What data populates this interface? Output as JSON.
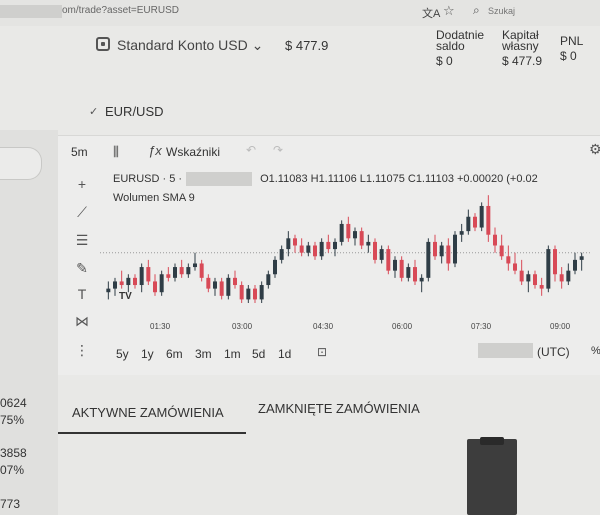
{
  "browser": {
    "url": "om/trade?asset=EURUSD",
    "search_placeholder": "Szukaj",
    "translate_glyph": "文A",
    "star_glyph": "☆",
    "search_glyph": "⌕"
  },
  "header": {
    "account_label": "Standard Konto USD ⌄",
    "balance": "$ 477.9",
    "stats": [
      {
        "label1": "Dodatnie",
        "label2": "saldo",
        "value": "$ 0"
      },
      {
        "label1": "Kapitał",
        "label2": "własny",
        "value": "$ 477.9"
      },
      {
        "label1": "PNL",
        "label2": "",
        "value": "$ 0"
      }
    ]
  },
  "instrument": {
    "check_glyph": "✓",
    "name": "EUR/USD"
  },
  "left_panel": {
    "values": [
      "0624",
      "75%",
      "3858",
      "07%",
      "773"
    ]
  },
  "chart_toolbar": {
    "interval": "5m",
    "candles_glyph": "⫼",
    "fx_glyph": "ƒx",
    "indicators_label": "Wskaźniki",
    "undo_glyph": "↶",
    "redo_glyph": "↷",
    "settings_glyph": "⚙"
  },
  "drawing_tools": {
    "crosshair_glyph": "+",
    "line_glyph": "⟋",
    "fib_glyph": "☰",
    "brush_glyph": "✎",
    "text_glyph": "T",
    "pattern_glyph": "⋈",
    "measure_glyph": "⋮"
  },
  "chart_data": {
    "type": "candlestick",
    "symbol_prefix": "EURUSD · 5 ·",
    "ohlc_text": "O1.11083 H1.11106 L1.11075 C1.11103 +0.00020 (+0.02",
    "volume_label": "Wolumen SMA 9",
    "time_labels": [
      "01:30",
      "03:00",
      "04:30",
      "06:00",
      "07:30",
      "09:00"
    ],
    "up_color": "#2f3d46",
    "down_color": "#d84a57",
    "ref_line": 1.1107,
    "ylim": [
      1.1093,
      1.1125
    ],
    "candles": [
      {
        "o": 1.1096,
        "h": 1.1099,
        "l": 1.1094,
        "c": 1.1097
      },
      {
        "o": 1.1097,
        "h": 1.11,
        "l": 1.1095,
        "c": 1.1099
      },
      {
        "o": 1.1099,
        "h": 1.1102,
        "l": 1.1097,
        "c": 1.1098
      },
      {
        "o": 1.1098,
        "h": 1.1101,
        "l": 1.1096,
        "c": 1.11
      },
      {
        "o": 1.11,
        "h": 1.1101,
        "l": 1.1097,
        "c": 1.1098
      },
      {
        "o": 1.1098,
        "h": 1.1104,
        "l": 1.1096,
        "c": 1.1103
      },
      {
        "o": 1.1103,
        "h": 1.1105,
        "l": 1.1098,
        "c": 1.1099
      },
      {
        "o": 1.1099,
        "h": 1.1101,
        "l": 1.1095,
        "c": 1.1096
      },
      {
        "o": 1.1096,
        "h": 1.1102,
        "l": 1.1095,
        "c": 1.1101
      },
      {
        "o": 1.1101,
        "h": 1.1103,
        "l": 1.1099,
        "c": 1.11
      },
      {
        "o": 1.11,
        "h": 1.1104,
        "l": 1.1099,
        "c": 1.1103
      },
      {
        "o": 1.1103,
        "h": 1.1105,
        "l": 1.11,
        "c": 1.1101
      },
      {
        "o": 1.1101,
        "h": 1.1104,
        "l": 1.11,
        "c": 1.1103
      },
      {
        "o": 1.1103,
        "h": 1.1107,
        "l": 1.1102,
        "c": 1.1104
      },
      {
        "o": 1.1104,
        "h": 1.1105,
        "l": 1.1099,
        "c": 1.11
      },
      {
        "o": 1.11,
        "h": 1.1101,
        "l": 1.1096,
        "c": 1.1097
      },
      {
        "o": 1.1097,
        "h": 1.11,
        "l": 1.1095,
        "c": 1.1099
      },
      {
        "o": 1.1099,
        "h": 1.11,
        "l": 1.1094,
        "c": 1.1095
      },
      {
        "o": 1.1095,
        "h": 1.1101,
        "l": 1.1094,
        "c": 1.11
      },
      {
        "o": 1.11,
        "h": 1.1102,
        "l": 1.1097,
        "c": 1.1098
      },
      {
        "o": 1.1098,
        "h": 1.1099,
        "l": 1.1093,
        "c": 1.1094
      },
      {
        "o": 1.1094,
        "h": 1.1098,
        "l": 1.1093,
        "c": 1.1097
      },
      {
        "o": 1.1097,
        "h": 1.1098,
        "l": 1.1093,
        "c": 1.1094
      },
      {
        "o": 1.1094,
        "h": 1.1099,
        "l": 1.1093,
        "c": 1.1098
      },
      {
        "o": 1.1098,
        "h": 1.1102,
        "l": 1.1097,
        "c": 1.1101
      },
      {
        "o": 1.1101,
        "h": 1.1106,
        "l": 1.11,
        "c": 1.1105
      },
      {
        "o": 1.1105,
        "h": 1.1109,
        "l": 1.1104,
        "c": 1.1108
      },
      {
        "o": 1.1108,
        "h": 1.1113,
        "l": 1.1106,
        "c": 1.1111
      },
      {
        "o": 1.1111,
        "h": 1.1112,
        "l": 1.1107,
        "c": 1.1109
      },
      {
        "o": 1.1109,
        "h": 1.1111,
        "l": 1.1106,
        "c": 1.1107
      },
      {
        "o": 1.1107,
        "h": 1.111,
        "l": 1.1106,
        "c": 1.1109
      },
      {
        "o": 1.1109,
        "h": 1.111,
        "l": 1.1105,
        "c": 1.1106
      },
      {
        "o": 1.1106,
        "h": 1.1111,
        "l": 1.1105,
        "c": 1.111
      },
      {
        "o": 1.111,
        "h": 1.1112,
        "l": 1.1107,
        "c": 1.1108
      },
      {
        "o": 1.1108,
        "h": 1.1111,
        "l": 1.1106,
        "c": 1.111
      },
      {
        "o": 1.111,
        "h": 1.1116,
        "l": 1.1109,
        "c": 1.1115
      },
      {
        "o": 1.1115,
        "h": 1.1117,
        "l": 1.111,
        "c": 1.1111
      },
      {
        "o": 1.1111,
        "h": 1.1114,
        "l": 1.1109,
        "c": 1.1113
      },
      {
        "o": 1.1113,
        "h": 1.1114,
        "l": 1.1108,
        "c": 1.1109
      },
      {
        "o": 1.1109,
        "h": 1.1112,
        "l": 1.1107,
        "c": 1.111
      },
      {
        "o": 1.111,
        "h": 1.1111,
        "l": 1.1104,
        "c": 1.1105
      },
      {
        "o": 1.1105,
        "h": 1.1109,
        "l": 1.1104,
        "c": 1.1108
      },
      {
        "o": 1.1108,
        "h": 1.1109,
        "l": 1.1101,
        "c": 1.1102
      },
      {
        "o": 1.1102,
        "h": 1.1106,
        "l": 1.11,
        "c": 1.1105
      },
      {
        "o": 1.1105,
        "h": 1.1106,
        "l": 1.1099,
        "c": 1.11
      },
      {
        "o": 1.11,
        "h": 1.1104,
        "l": 1.1099,
        "c": 1.1103
      },
      {
        "o": 1.1103,
        "h": 1.1105,
        "l": 1.1098,
        "c": 1.1099
      },
      {
        "o": 1.1099,
        "h": 1.1101,
        "l": 1.1096,
        "c": 1.11
      },
      {
        "o": 1.11,
        "h": 1.1111,
        "l": 1.1099,
        "c": 1.111
      },
      {
        "o": 1.111,
        "h": 1.1112,
        "l": 1.1105,
        "c": 1.1106
      },
      {
        "o": 1.1106,
        "h": 1.111,
        "l": 1.1104,
        "c": 1.1109
      },
      {
        "o": 1.1109,
        "h": 1.1111,
        "l": 1.1102,
        "c": 1.1104
      },
      {
        "o": 1.1104,
        "h": 1.1113,
        "l": 1.1103,
        "c": 1.1112
      },
      {
        "o": 1.1112,
        "h": 1.1115,
        "l": 1.111,
        "c": 1.1113
      },
      {
        "o": 1.1113,
        "h": 1.1119,
        "l": 1.1112,
        "c": 1.1117
      },
      {
        "o": 1.1117,
        "h": 1.1118,
        "l": 1.1113,
        "c": 1.1114
      },
      {
        "o": 1.1114,
        "h": 1.1121,
        "l": 1.1113,
        "c": 1.112
      },
      {
        "o": 1.112,
        "h": 1.1123,
        "l": 1.111,
        "c": 1.1112
      },
      {
        "o": 1.1112,
        "h": 1.1114,
        "l": 1.1107,
        "c": 1.1109
      },
      {
        "o": 1.1109,
        "h": 1.1112,
        "l": 1.1105,
        "c": 1.1106
      },
      {
        "o": 1.1106,
        "h": 1.1109,
        "l": 1.1102,
        "c": 1.1104
      },
      {
        "o": 1.1104,
        "h": 1.1107,
        "l": 1.1101,
        "c": 1.1102
      },
      {
        "o": 1.1102,
        "h": 1.1105,
        "l": 1.1098,
        "c": 1.1099
      },
      {
        "o": 1.1099,
        "h": 1.1102,
        "l": 1.1096,
        "c": 1.1101
      },
      {
        "o": 1.1101,
        "h": 1.1102,
        "l": 1.1097,
        "c": 1.1098
      },
      {
        "o": 1.1098,
        "h": 1.11,
        "l": 1.1095,
        "c": 1.1097
      },
      {
        "o": 1.1097,
        "h": 1.1109,
        "l": 1.1096,
        "c": 1.1108
      },
      {
        "o": 1.1108,
        "h": 1.1109,
        "l": 1.1099,
        "c": 1.1101
      },
      {
        "o": 1.1101,
        "h": 1.1103,
        "l": 1.1097,
        "c": 1.1099
      },
      {
        "o": 1.1099,
        "h": 1.1104,
        "l": 1.1098,
        "c": 1.1102
      },
      {
        "o": 1.1102,
        "h": 1.1107,
        "l": 1.1101,
        "c": 1.1105
      },
      {
        "o": 1.1105,
        "h": 1.1107,
        "l": 1.1102,
        "c": 1.1106
      }
    ]
  },
  "range_bar": {
    "ranges": [
      "5y",
      "1y",
      "6m",
      "3m",
      "1m",
      "5d",
      "1d"
    ],
    "calendar_glyph": "⊡",
    "timezone": "(UTC)",
    "percent": "%"
  },
  "orders": {
    "tab_active": "AKTYWNE ZAMÓWIENIA",
    "tab_closed": "ZAMKNIĘTE ZAMÓWIENIA"
  }
}
